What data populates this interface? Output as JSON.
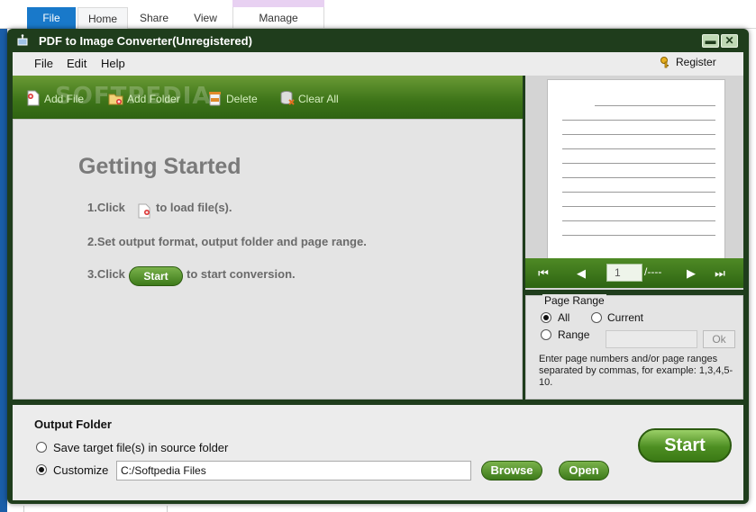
{
  "explorer": {
    "tabs": [
      "File",
      "Home",
      "Share",
      "View",
      "Manage"
    ]
  },
  "app": {
    "title": "PDF to Image Converter(Unregistered)",
    "min_symbol": "▬",
    "close_symbol": "✕"
  },
  "menu": {
    "items": [
      "File",
      "Edit",
      "Help"
    ],
    "register": "Register"
  },
  "toolbar": {
    "add_file": "Add File",
    "add_folder": "Add Folder",
    "delete": "Delete",
    "clear_all": "Clear All",
    "watermark": "SOFTPEDIA"
  },
  "getting_started": {
    "title": "Getting Started",
    "step1_prefix": "1.Click",
    "step1_suffix": "to load file(s).",
    "step2": "2.Set output format, output folder and page range.",
    "step3_prefix": "3.Click",
    "step3_button": "Start",
    "step3_suffix": "to start conversion."
  },
  "preview": {
    "page_value": "1",
    "page_total": "/----",
    "nav": {
      "first": "⏮",
      "prev": "◀",
      "next": "▶",
      "last": "⏭"
    }
  },
  "page_range": {
    "legend": "Page Range",
    "all": "All",
    "current": "Current",
    "range": "Range",
    "ok": "Ok",
    "help": "Enter page numbers and/or page ranges separated by commas, for example: 1,3,4,5-10.",
    "selected": "All"
  },
  "output": {
    "title": "Output Folder",
    "option_source": "Save target file(s) in source folder",
    "option_custom": "Customize",
    "path": "C:/Softpedia Files",
    "browse": "Browse",
    "open": "Open",
    "start": "Start",
    "selected": "Customize"
  },
  "colors": {
    "accent_green": "#3c7318",
    "window_frame": "#1f3d1c",
    "explorer_file_tab": "#1979ca"
  }
}
